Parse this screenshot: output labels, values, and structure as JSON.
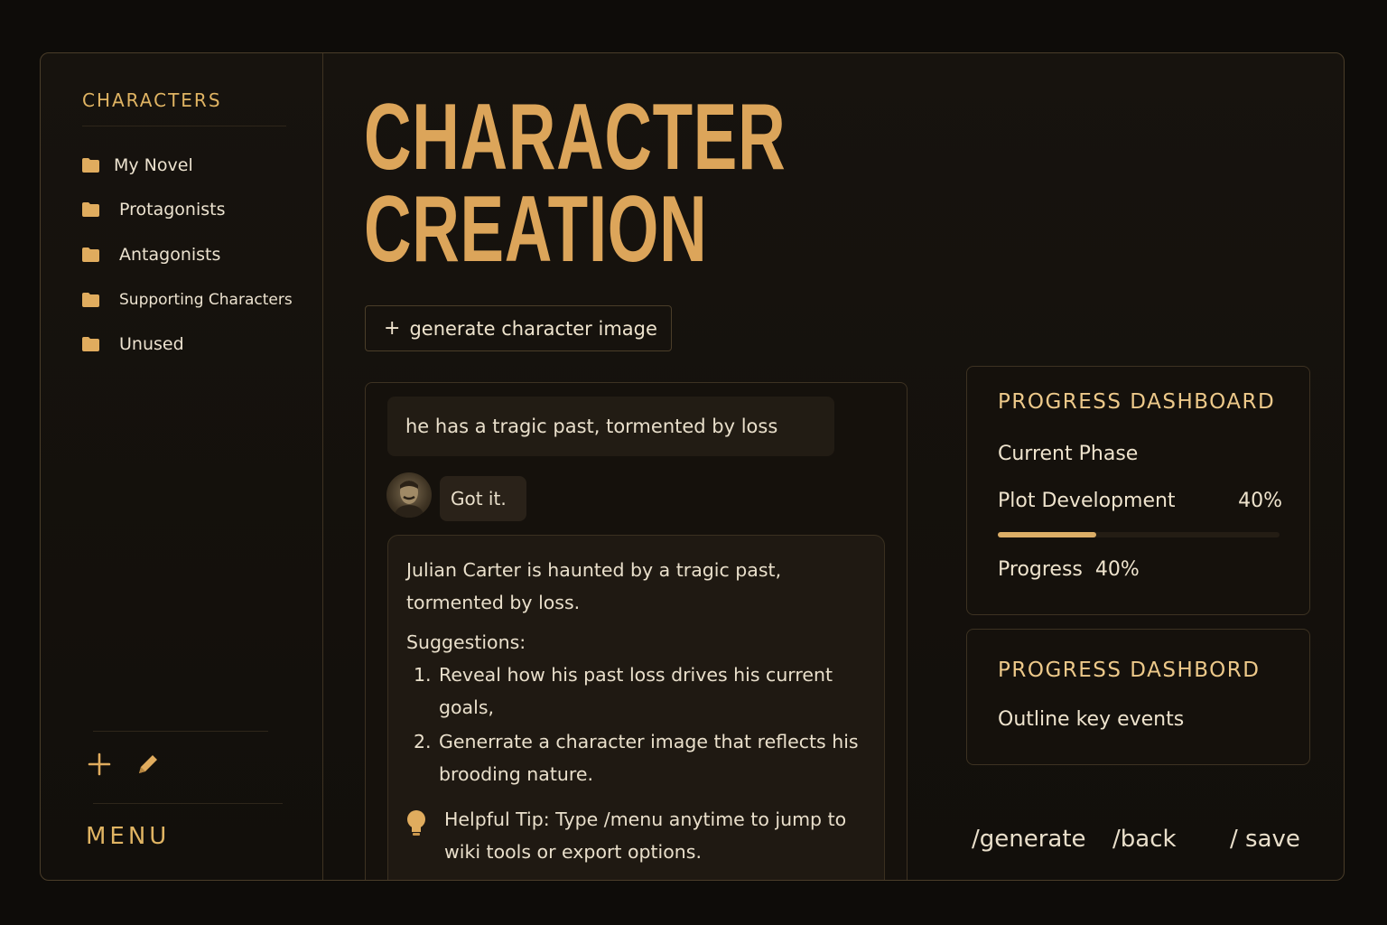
{
  "sidebar": {
    "title": "CHARACTERS",
    "items": [
      {
        "label": "My Novel"
      },
      {
        "label": "Protagonists"
      },
      {
        "label": "Antagonists"
      },
      {
        "label": "Supporting Characters"
      },
      {
        "label": "Unused"
      }
    ],
    "menu_label": "MENU",
    "icons": [
      "folder-icon",
      "plus-icon",
      "pencil-icon"
    ]
  },
  "main": {
    "title_line1": "CHARACTER",
    "title_line2": "CREATION",
    "generate_button": {
      "plus": "+",
      "label": "generate character image"
    }
  },
  "chat": {
    "user_message": "he has a tragic past, tormented by loss",
    "bot_short_reply": "Got it.",
    "bot_reply": {
      "intro": "Julian Carter is haunted by a tragic past, tormented by loss.",
      "suggestions_heading": "Suggestions:",
      "suggestions": [
        {
          "num": "1.",
          "text": "Reveal how his past loss drives his current goals,"
        },
        {
          "num": "2.",
          "text": "Generrate a character image that reflects his brooding nature."
        }
      ],
      "tip": "Helpful Tip: Type /menu anytime to jump to wiki tools or export options."
    }
  },
  "dashboard1": {
    "title": "PROGRESS DASHBOARD",
    "phase_label": "Current Phase",
    "phase_name": "Plot Development",
    "phase_pct": "40%",
    "progress_fraction": 0.35,
    "progress_text": "Progress  40%"
  },
  "dashboard2": {
    "title": "PROGRESS DASHBORD",
    "item": "Outline key events"
  },
  "commands": {
    "generate": "/generate",
    "back": "/back",
    "save": "/ save"
  },
  "colors": {
    "accent": "#dca55a",
    "background": "#0e0c09",
    "text": "#e9dfcb"
  }
}
